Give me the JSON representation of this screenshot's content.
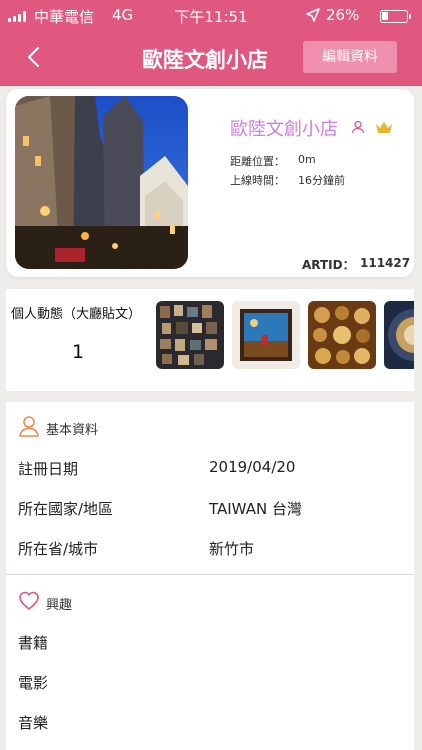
{
  "status_bar": {
    "carrier": "中華電信",
    "network": "4G",
    "time": "下午11:51",
    "battery_text": "26%",
    "battery_level": 0.26
  },
  "nav": {
    "title": "歐陸文創小店",
    "edit_label": "編輯資料"
  },
  "profile": {
    "name": "歐陸文創小店",
    "distance_label": "距離位置：",
    "distance_value": "0m",
    "online_label": "上線時間：",
    "online_value": "16分鐘前",
    "artid_label": "ARTID：",
    "artid_value": "111427"
  },
  "feed": {
    "label": "個人動態（大廳貼文）",
    "count": "1"
  },
  "basic_info": {
    "title": "基本資料",
    "fields": [
      {
        "label": "註冊日期",
        "value": "2019/04/20"
      },
      {
        "label": "所在國家/地區",
        "value": "TAIWAN 台灣"
      },
      {
        "label": "所在省/城市",
        "value": "新竹市"
      }
    ]
  },
  "interests": {
    "title": "興趣",
    "items": [
      "書籍",
      "電影",
      "音樂"
    ]
  },
  "colors": {
    "accent": "#e0577f",
    "name_purple": "#c97fe0",
    "crown_gold": "#e8b531",
    "icon_orange": "#f08a4b",
    "heart_pink": "#e0577f"
  }
}
